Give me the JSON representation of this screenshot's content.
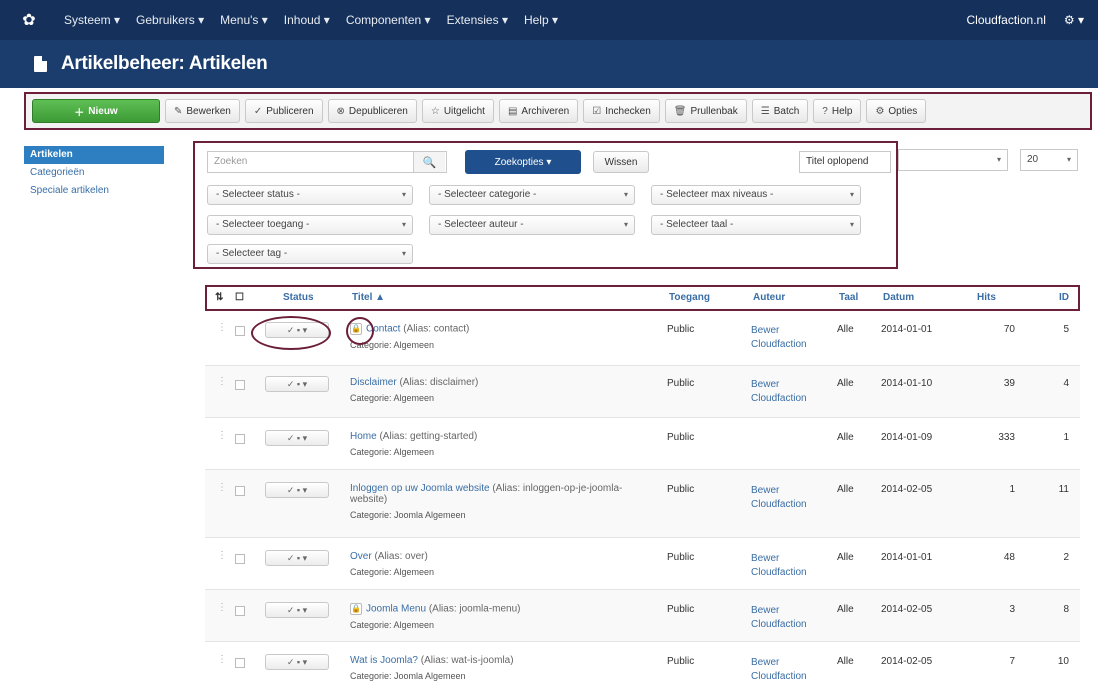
{
  "topnav": {
    "menu": [
      "Systeem ▾",
      "Gebruikers ▾",
      "Menu's ▾",
      "Inhoud ▾",
      "Componenten ▾",
      "Extensies ▾",
      "Help ▾"
    ],
    "user": "Cloudfaction.nl",
    "gear": "⚙ ▾"
  },
  "page_title": "Artikelbeheer: Artikelen",
  "toolbar": {
    "new": "Nieuw",
    "edit": "Bewerken",
    "publish": "Publiceren",
    "unpublish": "Depubliceren",
    "feature": "Uitgelicht",
    "archive": "Archiveren",
    "checkin": "Inchecken",
    "trash": "Prullenbak",
    "batch": "Batch",
    "help": "Help",
    "options": "Opties"
  },
  "sidebar": {
    "items": [
      "Artikelen",
      "Categorieën",
      "Speciale artikelen"
    ]
  },
  "filters": {
    "search_placeholder": "Zoeken",
    "search_tools": "Zoekopties ▾",
    "clear": "Wissen",
    "sort": "Titel oplopend",
    "select_status": "- Selecteer status -",
    "select_category": "- Selecteer categorie -",
    "select_max_levels": "- Selecteer max niveaus -",
    "select_access": "- Selecteer toegang -",
    "select_author": "- Selecteer auteur -",
    "select_language": "- Selecteer taal -",
    "select_tag": "- Selecteer tag -",
    "outer_limit": "20"
  },
  "table": {
    "headers": {
      "status": "Status",
      "title": "Titel ▲",
      "access": "Toegang",
      "author": "Auteur",
      "language": "Taal",
      "date": "Datum",
      "hits": "Hits",
      "id": "ID"
    },
    "rows": [
      {
        "title": "Contact",
        "alias": "(Alias: contact)",
        "category": "Categorie: Algemeen",
        "access": "Public",
        "author": "Bewer Cloudfaction",
        "lang": "Alle",
        "date": "2014-01-01",
        "hits": "70",
        "id": "5",
        "locked": true
      },
      {
        "title": "Disclaimer",
        "alias": "(Alias: disclaimer)",
        "category": "Categorie: Algemeen",
        "access": "Public",
        "author": "Bewer Cloudfaction",
        "lang": "Alle",
        "date": "2014-01-10",
        "hits": "39",
        "id": "4",
        "locked": false
      },
      {
        "title": "Home",
        "alias": "(Alias: getting-started)",
        "category": "Categorie: Algemeen",
        "access": "Public",
        "author": "",
        "lang": "Alle",
        "date": "2014-01-09",
        "hits": "333",
        "id": "1",
        "locked": false
      },
      {
        "title": "Inloggen op uw Joomla website",
        "alias": "(Alias: inloggen-op-je-joomla-website)",
        "category": "Categorie: Joomla Algemeen",
        "access": "Public",
        "author": "Bewer Cloudfaction",
        "lang": "Alle",
        "date": "2014-02-05",
        "hits": "1",
        "id": "11",
        "locked": false
      },
      {
        "title": "Over",
        "alias": "(Alias: over)",
        "category": "Categorie: Algemeen",
        "access": "Public",
        "author": "Bewer Cloudfaction",
        "lang": "Alle",
        "date": "2014-01-01",
        "hits": "48",
        "id": "2",
        "locked": false
      },
      {
        "title": "Joomla Menu",
        "alias": "(Alias: joomla-menu)",
        "category": "Categorie: Algemeen",
        "access": "Public",
        "author": "Bewer Cloudfaction",
        "lang": "Alle",
        "date": "2014-02-05",
        "hits": "3",
        "id": "8",
        "locked": true
      },
      {
        "title": "Wat is Joomla?",
        "alias": "(Alias: wat-is-joomla)",
        "category": "Categorie: Joomla Algemeen",
        "access": "Public",
        "author": "Bewer Cloudfaction",
        "lang": "Alle",
        "date": "2014-02-05",
        "hits": "7",
        "id": "10",
        "locked": false
      }
    ]
  }
}
